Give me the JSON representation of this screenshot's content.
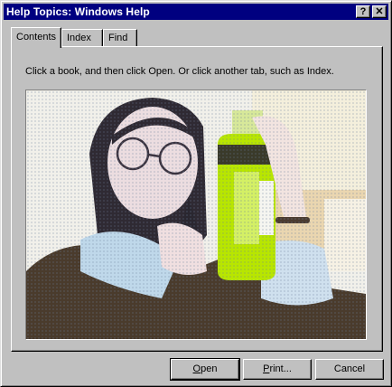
{
  "window": {
    "title": "Help Topics: Windows Help"
  },
  "titlebar_buttons": {
    "help": "?",
    "close": "✕"
  },
  "tabs": [
    {
      "label": "Contents",
      "active": true
    },
    {
      "label": "Index",
      "active": false
    },
    {
      "label": "Find",
      "active": false
    }
  ],
  "panel": {
    "instruction": "Click a book, and then click Open. Or click another tab, such as Index."
  },
  "buttons": {
    "open": {
      "accel": "O",
      "rest": "pen"
    },
    "print": {
      "accel": "P",
      "rest": "rint..."
    },
    "cancel": "Cancel"
  },
  "colors": {
    "title_bar": "#000080",
    "face": "#c0c0c0",
    "bottle_liquid": "#b8e600"
  }
}
